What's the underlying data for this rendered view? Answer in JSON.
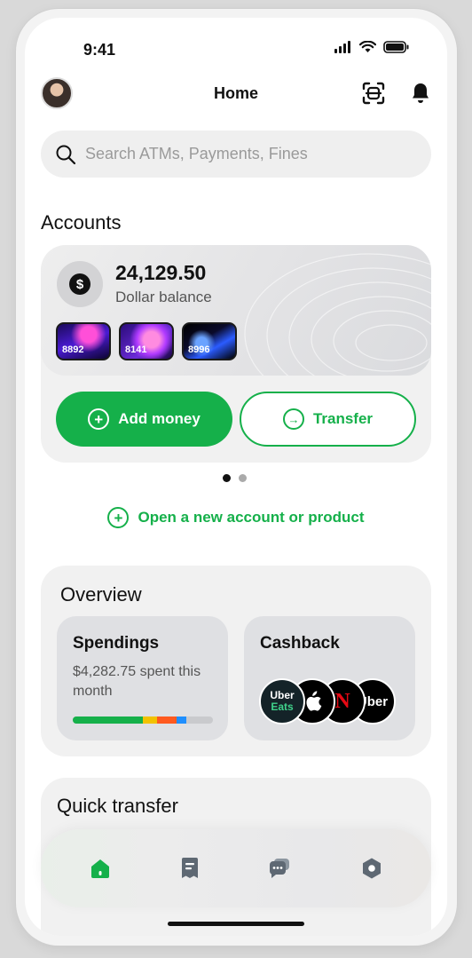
{
  "status_bar": {
    "time": "9:41"
  },
  "header": {
    "title": "Home"
  },
  "search": {
    "placeholder": "Search ATMs, Payments, Fines"
  },
  "accounts": {
    "title": "Accounts",
    "balance": "24,129.50",
    "balance_label": "Dollar balance",
    "currency_symbol": "$",
    "cards": [
      {
        "last4": "8892"
      },
      {
        "last4": "8141"
      },
      {
        "last4": "8996"
      }
    ],
    "add_money_label": "Add money",
    "transfer_label": "Transfer",
    "carousel": {
      "pages": 2,
      "active_page": 1
    }
  },
  "open_account_label": "Open a new account or product",
  "overview": {
    "title": "Overview",
    "spendings": {
      "title": "Spendings",
      "spent_text": "$4,282.75 spent this month",
      "bar_segments": [
        {
          "color": "#15b04a",
          "fraction": 0.5
        },
        {
          "color": "#f2c200",
          "fraction": 0.1
        },
        {
          "color": "#ff5a1f",
          "fraction": 0.14
        },
        {
          "color": "#1f8fff",
          "fraction": 0.07
        }
      ]
    },
    "cashback": {
      "title": "Cashback",
      "brands": [
        "Uber Eats",
        "Apple",
        "Netflix",
        "Uber"
      ],
      "uber_eats_top": "Uber",
      "uber_eats_bottom": "Eats",
      "netflix_letter": "N",
      "uber_text": "Uber"
    }
  },
  "quick_transfer": {
    "title": "Quick transfer"
  },
  "tab_bar": {
    "tabs": [
      {
        "icon": "home-icon",
        "active": true
      },
      {
        "icon": "receipt-icon",
        "active": false
      },
      {
        "icon": "chat-icon",
        "active": false
      },
      {
        "icon": "settings-icon",
        "active": false
      }
    ]
  },
  "colors": {
    "accent": "#15b04a",
    "text": "#111111",
    "muted": "#555555",
    "surface": "#f1f1f1"
  }
}
